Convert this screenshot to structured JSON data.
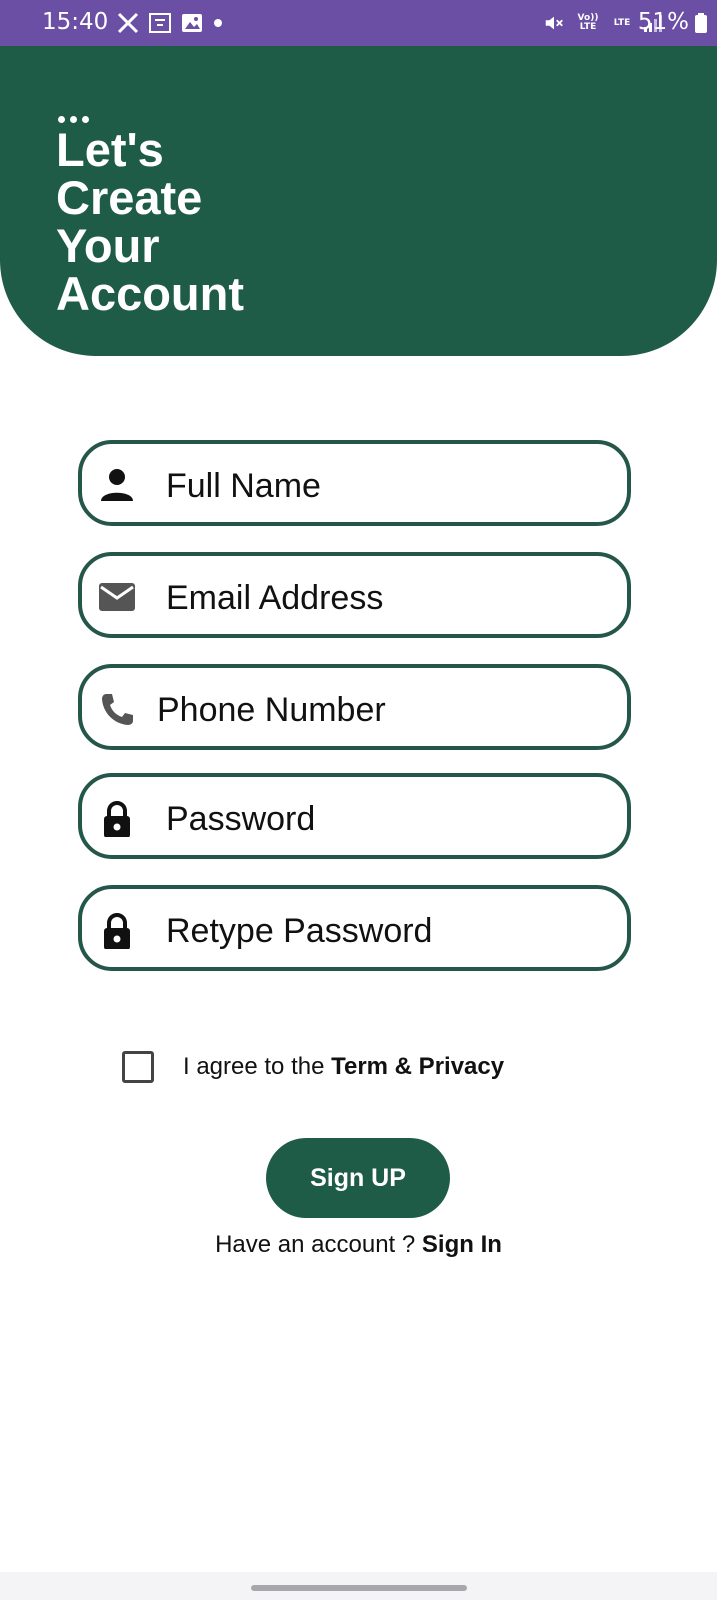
{
  "status_bar": {
    "time": "15:40",
    "battery": "51%",
    "volte_label": "Vo)) LTE",
    "lte_label": "LTE"
  },
  "header": {
    "title": "Let's\nCreate\nYour\nAccount",
    "background": "#1f5c48"
  },
  "form": {
    "fields": [
      {
        "label": "Full Name",
        "icon": "person-icon"
      },
      {
        "label": "Email Address",
        "icon": "mail-icon"
      },
      {
        "label": "Phone Number",
        "icon": "phone-icon"
      },
      {
        "label": "Password",
        "icon": "lock-icon"
      },
      {
        "label": "Retype Password",
        "icon": "lock-icon"
      }
    ],
    "agree_prefix": "I agree to the ",
    "agree_link": "Term & Privacy",
    "agree_checked": false,
    "signup_label": "Sign UP",
    "account_prefix": "Have an account ? ",
    "signin_label": "Sign In"
  },
  "colors": {
    "status_bar": "#6a4fa5",
    "accent": "#1f5c48",
    "field_border": "#24574a"
  }
}
